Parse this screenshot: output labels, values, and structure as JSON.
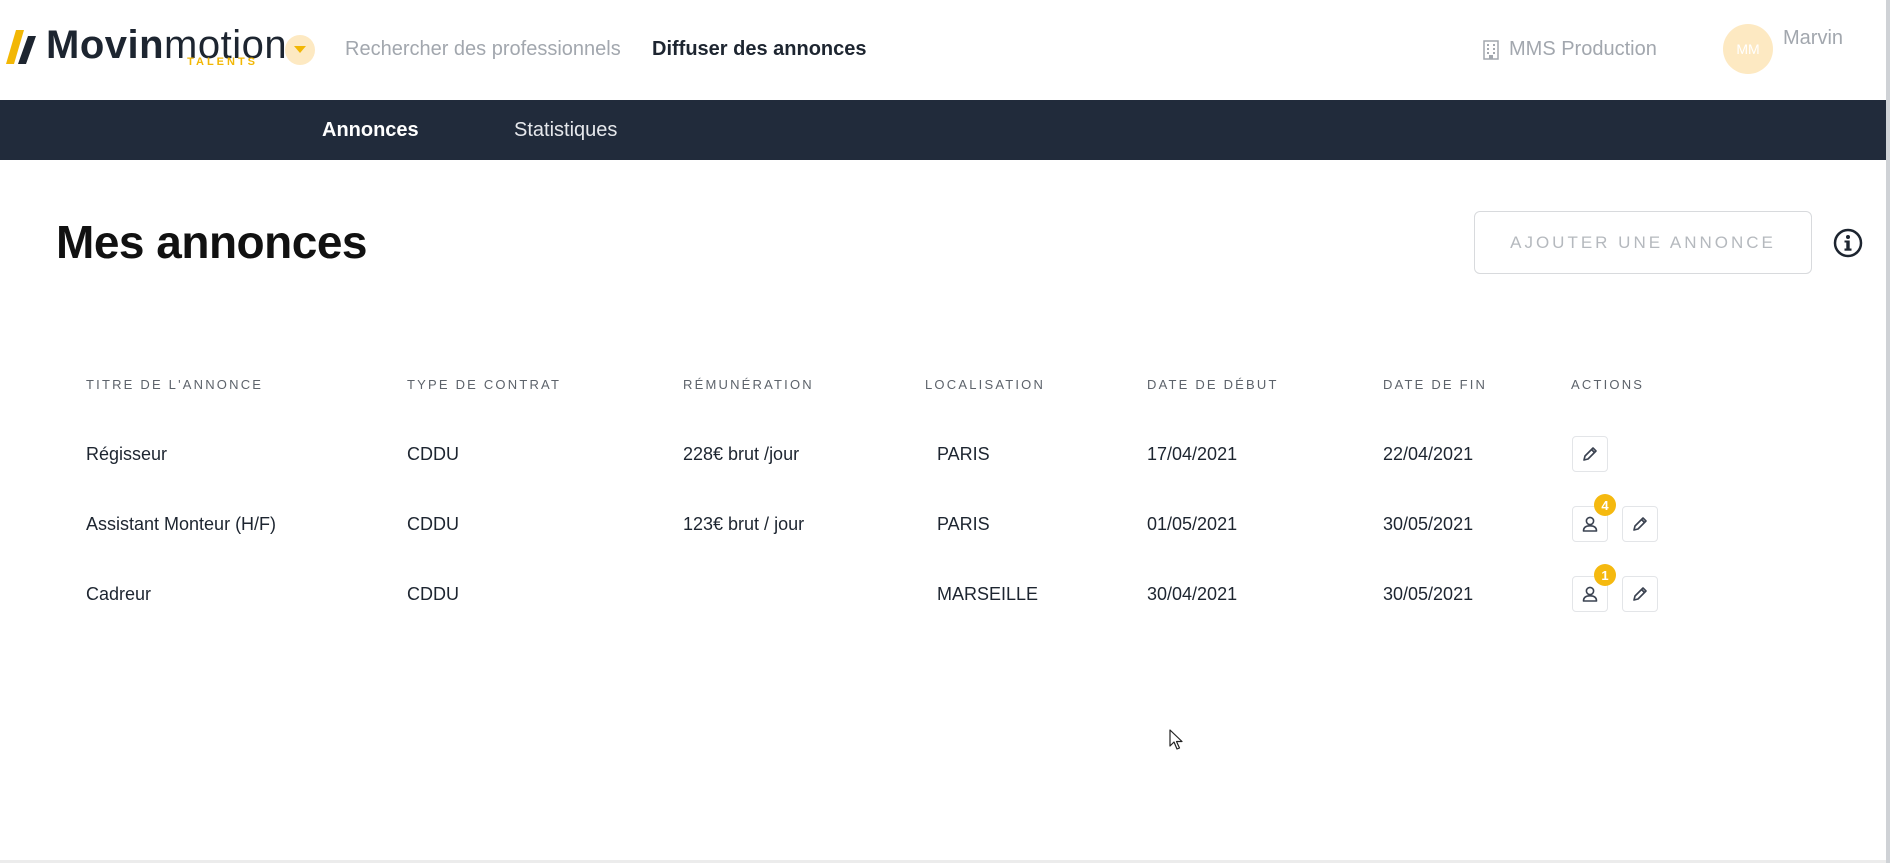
{
  "header": {
    "logo_main_bold": "Movin",
    "logo_main_light": "motion",
    "logo_sub": "TALENTS",
    "nav": {
      "search": "Rechercher des professionnels",
      "post": "Diffuser des annonces"
    },
    "company": "MMS Production",
    "user": {
      "initials": "MM",
      "name": "Marvin"
    }
  },
  "subnav": {
    "tabs": [
      {
        "label": "Annonces",
        "active": true
      },
      {
        "label": "Statistiques",
        "active": false
      }
    ]
  },
  "main": {
    "title": "Mes annonces",
    "add_button": "AJOUTER UNE ANNONCE"
  },
  "table": {
    "columns": [
      "TITRE DE L'ANNONCE",
      "TYPE DE CONTRAT",
      "RÉMUNÉRATION",
      "LOCALISATION",
      "DATE DE DÉBUT",
      "DATE DE FIN",
      "ACTIONS"
    ],
    "rows": [
      {
        "title": "Régisseur",
        "contract": "CDDU",
        "pay": "228€ brut /jour",
        "location": "PARIS",
        "start": "17/04/2021",
        "end": "22/04/2021",
        "candidates": null
      },
      {
        "title": "Assistant Monteur (H/F)",
        "contract": "CDDU",
        "pay": "123€ brut / jour",
        "location": "PARIS",
        "start": "01/05/2021",
        "end": "30/05/2021",
        "candidates": "4"
      },
      {
        "title": "Cadreur",
        "contract": "CDDU",
        "pay": "",
        "location": "MARSEILLE",
        "start": "30/04/2021",
        "end": "30/05/2021",
        "candidates": "1"
      }
    ]
  },
  "colors": {
    "accent": "#f5b90f",
    "nav_bg": "#212b3b",
    "muted_text": "#a2a7ae"
  },
  "icons": [
    "chevron-down-icon",
    "building-icon",
    "info-icon",
    "pencil-icon",
    "person-icon",
    "cursor-icon"
  ]
}
